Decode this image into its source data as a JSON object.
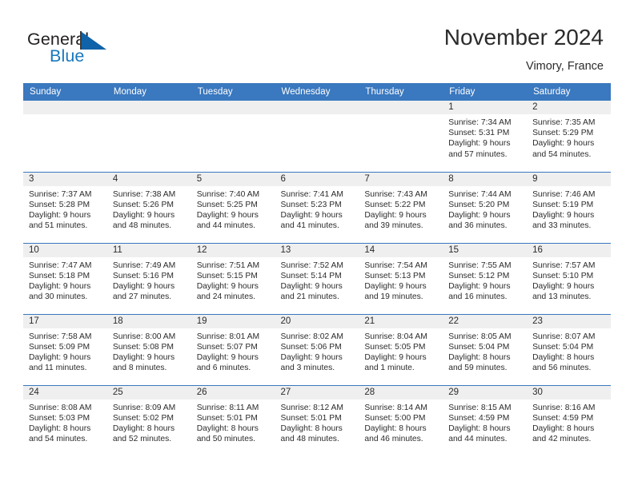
{
  "brand": {
    "word1": "General",
    "word2": "Blue",
    "accent_color": "#1878be",
    "flag_color": "#1063a8"
  },
  "header": {
    "title": "November 2024",
    "location": "Vimory, France"
  },
  "calendar": {
    "header_bg": "#3a78bf",
    "daynum_bg": "#efeff0",
    "weekdays": [
      "Sunday",
      "Monday",
      "Tuesday",
      "Wednesday",
      "Thursday",
      "Friday",
      "Saturday"
    ],
    "weeks": [
      [
        {
          "empty": true
        },
        {
          "empty": true
        },
        {
          "empty": true
        },
        {
          "empty": true
        },
        {
          "empty": true
        },
        {
          "day": "1",
          "sunrise": "Sunrise: 7:34 AM",
          "sunset": "Sunset: 5:31 PM",
          "daylight1": "Daylight: 9 hours",
          "daylight2": "and 57 minutes."
        },
        {
          "day": "2",
          "sunrise": "Sunrise: 7:35 AM",
          "sunset": "Sunset: 5:29 PM",
          "daylight1": "Daylight: 9 hours",
          "daylight2": "and 54 minutes."
        }
      ],
      [
        {
          "day": "3",
          "sunrise": "Sunrise: 7:37 AM",
          "sunset": "Sunset: 5:28 PM",
          "daylight1": "Daylight: 9 hours",
          "daylight2": "and 51 minutes."
        },
        {
          "day": "4",
          "sunrise": "Sunrise: 7:38 AM",
          "sunset": "Sunset: 5:26 PM",
          "daylight1": "Daylight: 9 hours",
          "daylight2": "and 48 minutes."
        },
        {
          "day": "5",
          "sunrise": "Sunrise: 7:40 AM",
          "sunset": "Sunset: 5:25 PM",
          "daylight1": "Daylight: 9 hours",
          "daylight2": "and 44 minutes."
        },
        {
          "day": "6",
          "sunrise": "Sunrise: 7:41 AM",
          "sunset": "Sunset: 5:23 PM",
          "daylight1": "Daylight: 9 hours",
          "daylight2": "and 41 minutes."
        },
        {
          "day": "7",
          "sunrise": "Sunrise: 7:43 AM",
          "sunset": "Sunset: 5:22 PM",
          "daylight1": "Daylight: 9 hours",
          "daylight2": "and 39 minutes."
        },
        {
          "day": "8",
          "sunrise": "Sunrise: 7:44 AM",
          "sunset": "Sunset: 5:20 PM",
          "daylight1": "Daylight: 9 hours",
          "daylight2": "and 36 minutes."
        },
        {
          "day": "9",
          "sunrise": "Sunrise: 7:46 AM",
          "sunset": "Sunset: 5:19 PM",
          "daylight1": "Daylight: 9 hours",
          "daylight2": "and 33 minutes."
        }
      ],
      [
        {
          "day": "10",
          "sunrise": "Sunrise: 7:47 AM",
          "sunset": "Sunset: 5:18 PM",
          "daylight1": "Daylight: 9 hours",
          "daylight2": "and 30 minutes."
        },
        {
          "day": "11",
          "sunrise": "Sunrise: 7:49 AM",
          "sunset": "Sunset: 5:16 PM",
          "daylight1": "Daylight: 9 hours",
          "daylight2": "and 27 minutes."
        },
        {
          "day": "12",
          "sunrise": "Sunrise: 7:51 AM",
          "sunset": "Sunset: 5:15 PM",
          "daylight1": "Daylight: 9 hours",
          "daylight2": "and 24 minutes."
        },
        {
          "day": "13",
          "sunrise": "Sunrise: 7:52 AM",
          "sunset": "Sunset: 5:14 PM",
          "daylight1": "Daylight: 9 hours",
          "daylight2": "and 21 minutes."
        },
        {
          "day": "14",
          "sunrise": "Sunrise: 7:54 AM",
          "sunset": "Sunset: 5:13 PM",
          "daylight1": "Daylight: 9 hours",
          "daylight2": "and 19 minutes."
        },
        {
          "day": "15",
          "sunrise": "Sunrise: 7:55 AM",
          "sunset": "Sunset: 5:12 PM",
          "daylight1": "Daylight: 9 hours",
          "daylight2": "and 16 minutes."
        },
        {
          "day": "16",
          "sunrise": "Sunrise: 7:57 AM",
          "sunset": "Sunset: 5:10 PM",
          "daylight1": "Daylight: 9 hours",
          "daylight2": "and 13 minutes."
        }
      ],
      [
        {
          "day": "17",
          "sunrise": "Sunrise: 7:58 AM",
          "sunset": "Sunset: 5:09 PM",
          "daylight1": "Daylight: 9 hours",
          "daylight2": "and 11 minutes."
        },
        {
          "day": "18",
          "sunrise": "Sunrise: 8:00 AM",
          "sunset": "Sunset: 5:08 PM",
          "daylight1": "Daylight: 9 hours",
          "daylight2": "and 8 minutes."
        },
        {
          "day": "19",
          "sunrise": "Sunrise: 8:01 AM",
          "sunset": "Sunset: 5:07 PM",
          "daylight1": "Daylight: 9 hours",
          "daylight2": "and 6 minutes."
        },
        {
          "day": "20",
          "sunrise": "Sunrise: 8:02 AM",
          "sunset": "Sunset: 5:06 PM",
          "daylight1": "Daylight: 9 hours",
          "daylight2": "and 3 minutes."
        },
        {
          "day": "21",
          "sunrise": "Sunrise: 8:04 AM",
          "sunset": "Sunset: 5:05 PM",
          "daylight1": "Daylight: 9 hours",
          "daylight2": "and 1 minute."
        },
        {
          "day": "22",
          "sunrise": "Sunrise: 8:05 AM",
          "sunset": "Sunset: 5:04 PM",
          "daylight1": "Daylight: 8 hours",
          "daylight2": "and 59 minutes."
        },
        {
          "day": "23",
          "sunrise": "Sunrise: 8:07 AM",
          "sunset": "Sunset: 5:04 PM",
          "daylight1": "Daylight: 8 hours",
          "daylight2": "and 56 minutes."
        }
      ],
      [
        {
          "day": "24",
          "sunrise": "Sunrise: 8:08 AM",
          "sunset": "Sunset: 5:03 PM",
          "daylight1": "Daylight: 8 hours",
          "daylight2": "and 54 minutes."
        },
        {
          "day": "25",
          "sunrise": "Sunrise: 8:09 AM",
          "sunset": "Sunset: 5:02 PM",
          "daylight1": "Daylight: 8 hours",
          "daylight2": "and 52 minutes."
        },
        {
          "day": "26",
          "sunrise": "Sunrise: 8:11 AM",
          "sunset": "Sunset: 5:01 PM",
          "daylight1": "Daylight: 8 hours",
          "daylight2": "and 50 minutes."
        },
        {
          "day": "27",
          "sunrise": "Sunrise: 8:12 AM",
          "sunset": "Sunset: 5:01 PM",
          "daylight1": "Daylight: 8 hours",
          "daylight2": "and 48 minutes."
        },
        {
          "day": "28",
          "sunrise": "Sunrise: 8:14 AM",
          "sunset": "Sunset: 5:00 PM",
          "daylight1": "Daylight: 8 hours",
          "daylight2": "and 46 minutes."
        },
        {
          "day": "29",
          "sunrise": "Sunrise: 8:15 AM",
          "sunset": "Sunset: 4:59 PM",
          "daylight1": "Daylight: 8 hours",
          "daylight2": "and 44 minutes."
        },
        {
          "day": "30",
          "sunrise": "Sunrise: 8:16 AM",
          "sunset": "Sunset: 4:59 PM",
          "daylight1": "Daylight: 8 hours",
          "daylight2": "and 42 minutes."
        }
      ]
    ]
  }
}
